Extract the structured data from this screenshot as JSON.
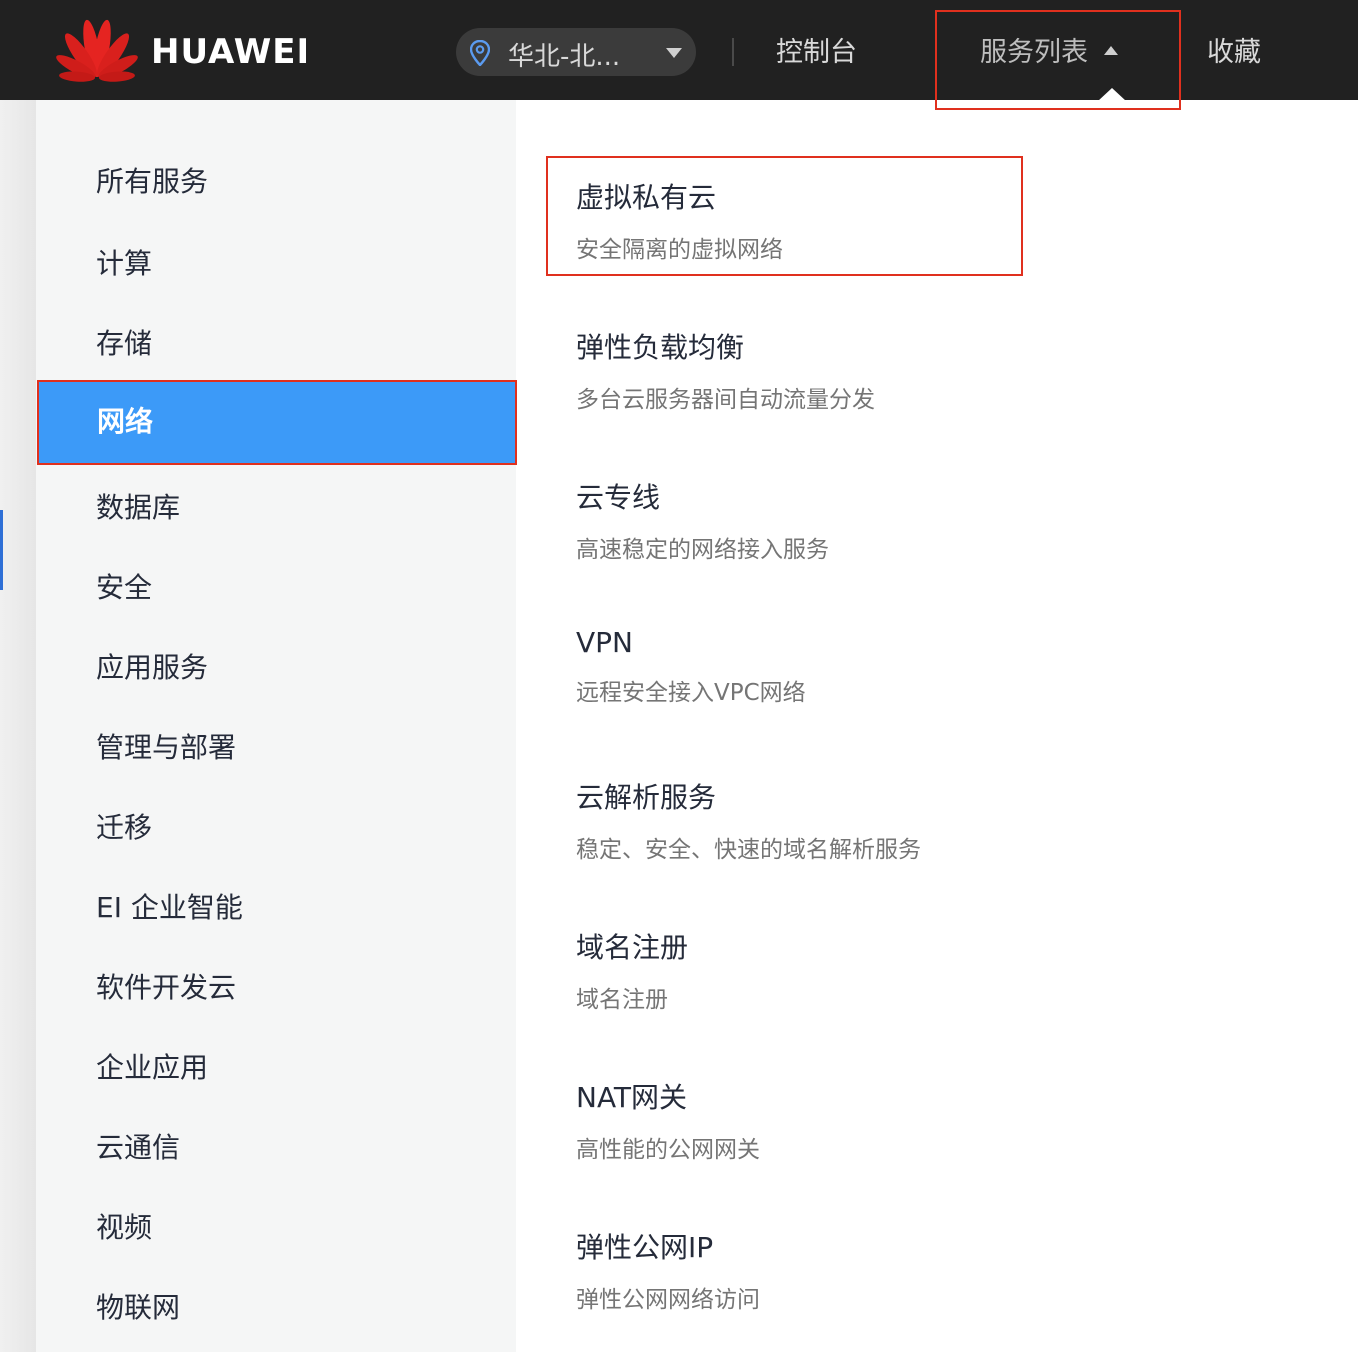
{
  "header": {
    "brand": "HUAWEI",
    "region": "华北-北...",
    "console": "控制台",
    "services": "服务列表",
    "favorites": "收藏"
  },
  "sidebar": {
    "categories": [
      {
        "label": "所有服务",
        "active": false
      },
      {
        "label": "计算",
        "active": false
      },
      {
        "label": "存储",
        "active": false
      },
      {
        "label": "网络",
        "active": true
      },
      {
        "label": "数据库",
        "active": false
      },
      {
        "label": "安全",
        "active": false
      },
      {
        "label": "应用服务",
        "active": false
      },
      {
        "label": "管理与部署",
        "active": false
      },
      {
        "label": "迁移",
        "active": false
      },
      {
        "label": "EI 企业智能",
        "active": false
      },
      {
        "label": "软件开发云",
        "active": false
      },
      {
        "label": "企业应用",
        "active": false
      },
      {
        "label": "云通信",
        "active": false
      },
      {
        "label": "视频",
        "active": false
      },
      {
        "label": "物联网",
        "active": false
      }
    ]
  },
  "services": [
    {
      "title": "虚拟私有云",
      "desc": "安全隔离的虚拟网络"
    },
    {
      "title": "弹性负载均衡",
      "desc": "多台云服务器间自动流量分发"
    },
    {
      "title": "云专线",
      "desc": "高速稳定的网络接入服务"
    },
    {
      "title": "VPN",
      "desc": "远程安全接入VPC网络"
    },
    {
      "title": "云解析服务",
      "desc": "稳定、安全、快速的域名解析服务"
    },
    {
      "title": "域名注册",
      "desc": "域名注册"
    },
    {
      "title": "NAT网关",
      "desc": "高性能的公网网关"
    },
    {
      "title": "弹性公网IP",
      "desc": "弹性公网网络访问"
    }
  ],
  "colors": {
    "header_bg": "#212121",
    "active_category": "#3c9af8",
    "highlight_border": "#e0301e"
  }
}
